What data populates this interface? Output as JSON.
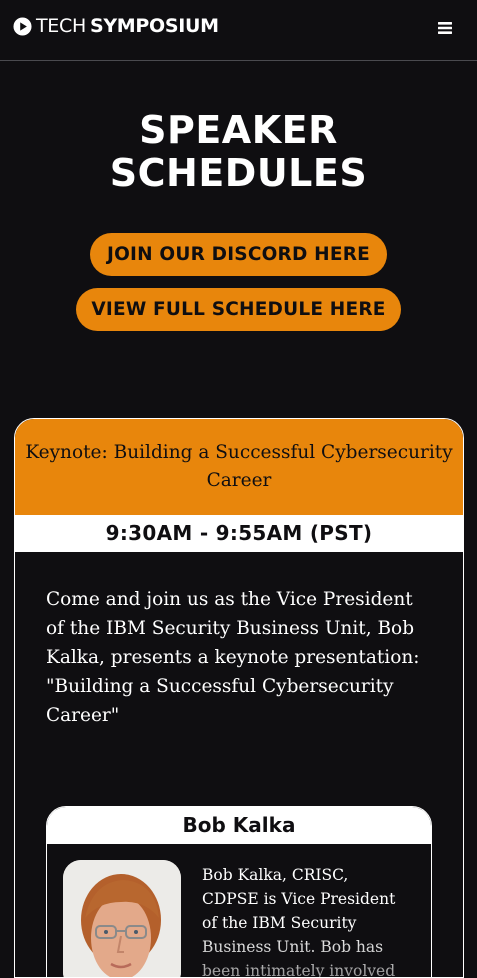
{
  "header": {
    "logo_text_light": "TECH",
    "logo_text_bold": "SYMPOSIUM",
    "logo_icon": "play-circle-icon",
    "menu_icon": "hamburger-menu-icon"
  },
  "hero": {
    "title_line1": "SPEAKER",
    "title_line2": "SCHEDULES",
    "cta_discord_label": "JOIN OUR DISCORD HERE",
    "cta_schedule_label": "VIEW FULL SCHEDULE HERE"
  },
  "session": {
    "title": "Keynote: Building a Successful Cybersecurity Career",
    "time": "9:30AM - 9:55AM (PST)",
    "description": "Come and join us as the Vice President of the IBM Security Business Unit, Bob Kalka, presents a keynote presentation: \"Building a Successful Cybersecurity Career\"",
    "speaker": {
      "name": "Bob Kalka",
      "bio": "Bob Kalka, CRISC, CDPSE is Vice President of the IBM Security Business Unit. Bob has been intimately involved"
    }
  },
  "colors": {
    "background": "#0f0e11",
    "accent": "#e8860c",
    "text": "#ffffff"
  }
}
